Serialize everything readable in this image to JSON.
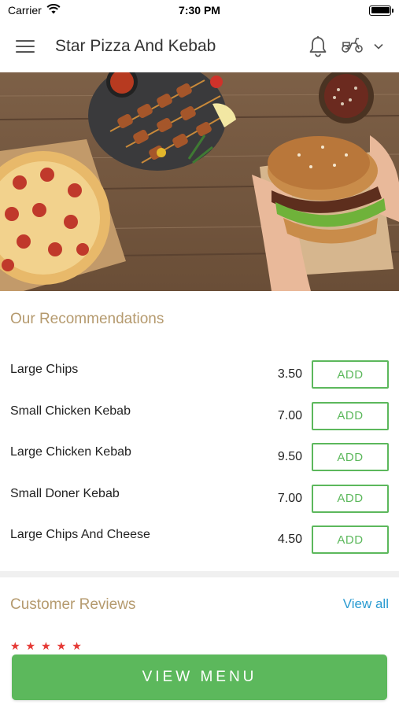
{
  "status_bar": {
    "carrier": "Carrier",
    "time": "7:30 PM",
    "icons": [
      "wifi-icon",
      "battery-icon"
    ]
  },
  "header": {
    "title": "Star Pizza And Kebab",
    "icons": [
      "hamburger-menu-icon",
      "bell-icon",
      "delivery-scooter-icon",
      "chevron-down-icon"
    ]
  },
  "hero": {
    "description_icon": "food-banner-image"
  },
  "recommendations": {
    "title": "Our Recommendations",
    "add_label": "ADD",
    "items": [
      {
        "name": "Large Chips",
        "price": "3.50"
      },
      {
        "name": "Small Chicken Kebab",
        "price": "7.00"
      },
      {
        "name": "Large Chicken Kebab",
        "price": "9.50"
      },
      {
        "name": "Small Doner Kebab",
        "price": "7.00"
      },
      {
        "name": "Large Chips And Cheese",
        "price": "4.50"
      }
    ]
  },
  "reviews": {
    "title": "Customer Reviews",
    "view_all": "View all"
  },
  "footer": {
    "view_menu": "VIEW MENU"
  },
  "colors": {
    "accent_green": "#5cb85c",
    "section_title": "#b59a6e",
    "link_blue": "#2a9bd1",
    "star_red": "#e53935"
  }
}
